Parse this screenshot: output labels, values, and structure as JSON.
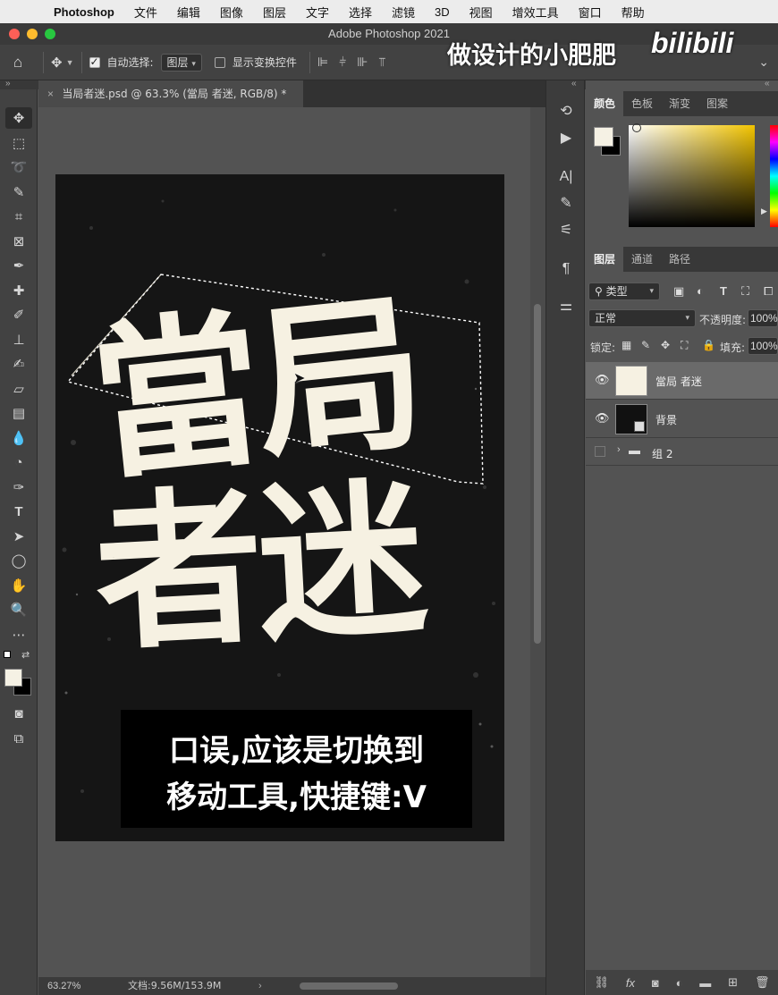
{
  "menubar": {
    "app": "Photoshop",
    "items": [
      "文件",
      "编辑",
      "图像",
      "图层",
      "文字",
      "选择",
      "滤镜",
      "3D",
      "视图",
      "增效工具",
      "窗口",
      "帮助"
    ]
  },
  "titlebar": {
    "title": "Adobe Photoshop 2021"
  },
  "watermark": {
    "text": "做设计的小肥肥",
    "logo": "bilibili"
  },
  "options": {
    "auto_select_label": "自动选择:",
    "auto_select_value": "图层",
    "show_transform_label": "显示变换控件"
  },
  "document": {
    "tab_title": "当局者迷.psd @ 63.3% (當局 者迷, RGB/8) *",
    "art_line1": [
      "當",
      "局"
    ],
    "art_line2": [
      "者",
      "迷"
    ],
    "caption_line1": "口误,应该是切换到",
    "caption_line2": "移动工具,快捷键:V"
  },
  "status": {
    "zoom": "63.27%",
    "doc_size": "文档:9.56M/153.9M"
  },
  "color_panel": {
    "tabs": [
      "颜色",
      "色板",
      "渐变",
      "图案"
    ],
    "hue_color": "#f2c400"
  },
  "layers_panel": {
    "tabs": [
      "图层",
      "通道",
      "路径"
    ],
    "filter_label": "类型",
    "blend_mode": "正常",
    "opacity_label": "不透明度:",
    "opacity_value": "100%",
    "lock_label": "锁定:",
    "fill_label": "填充:",
    "fill_value": "100%",
    "layers": [
      {
        "name": "當局 者迷",
        "visible": true,
        "selected": true
      },
      {
        "name": "背景",
        "visible": true,
        "selected": false
      },
      {
        "name": "组 2",
        "visible": false,
        "selected": false
      }
    ]
  }
}
